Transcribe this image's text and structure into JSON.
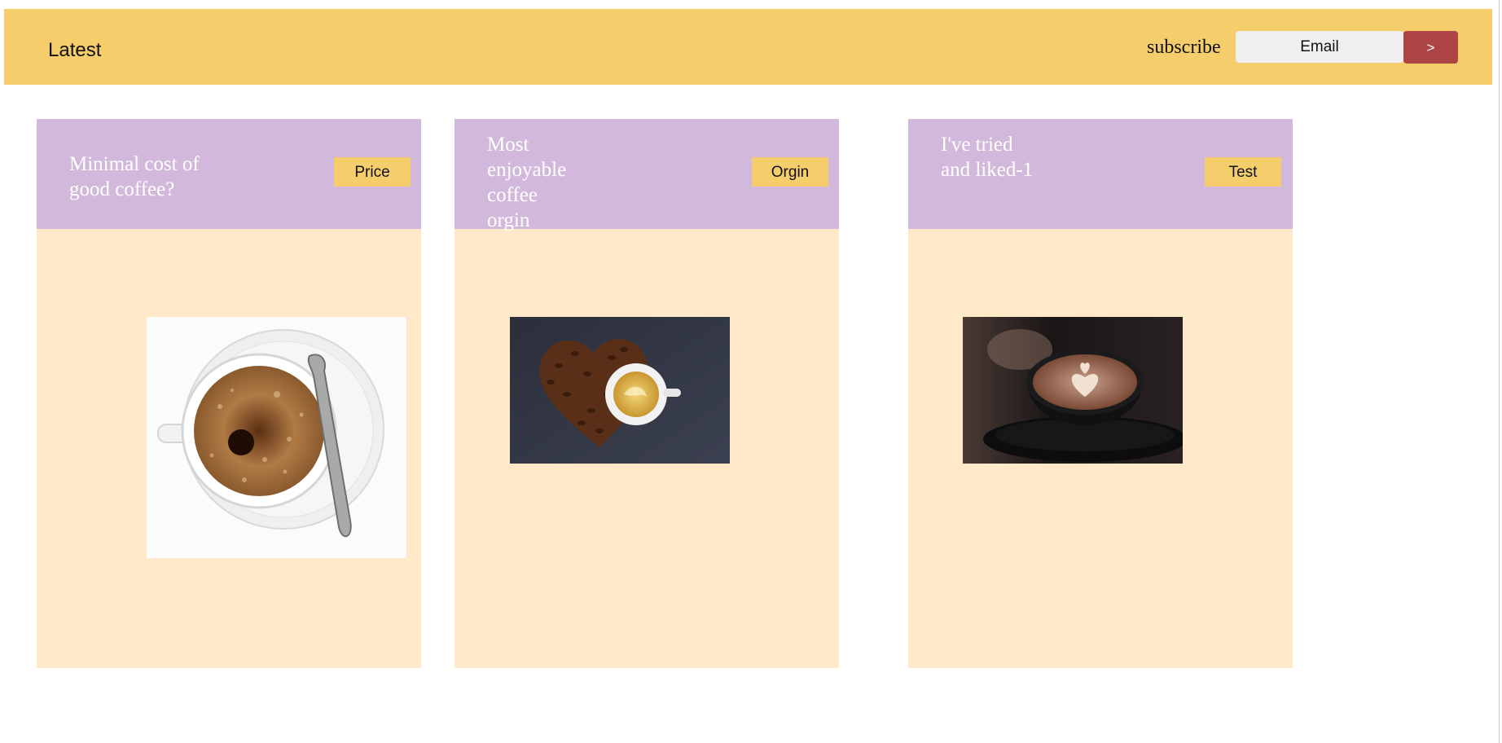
{
  "header": {
    "brand": "Latest",
    "subscribe_label": "subscribe",
    "email_placeholder": "Email",
    "submit_label": ">"
  },
  "cards": [
    {
      "title": "Minimal cost of good coffee?",
      "tag": "Price",
      "image": "coffee-cup-with-spoon-image"
    },
    {
      "title": "Most enjoyable coffee orgin",
      "tag": "Orgin",
      "image": "coffee-bean-heart-image"
    },
    {
      "title": "I've tried and liked-1",
      "tag": "Test",
      "image": "latte-art-image"
    }
  ],
  "colors": {
    "header_bg": "#f5cd6b",
    "card_head_bg": "#d2b9dc",
    "card_body_bg": "#ffe9c9",
    "submit_bg": "#ad4545",
    "tag_bg": "#f5cd6b"
  }
}
